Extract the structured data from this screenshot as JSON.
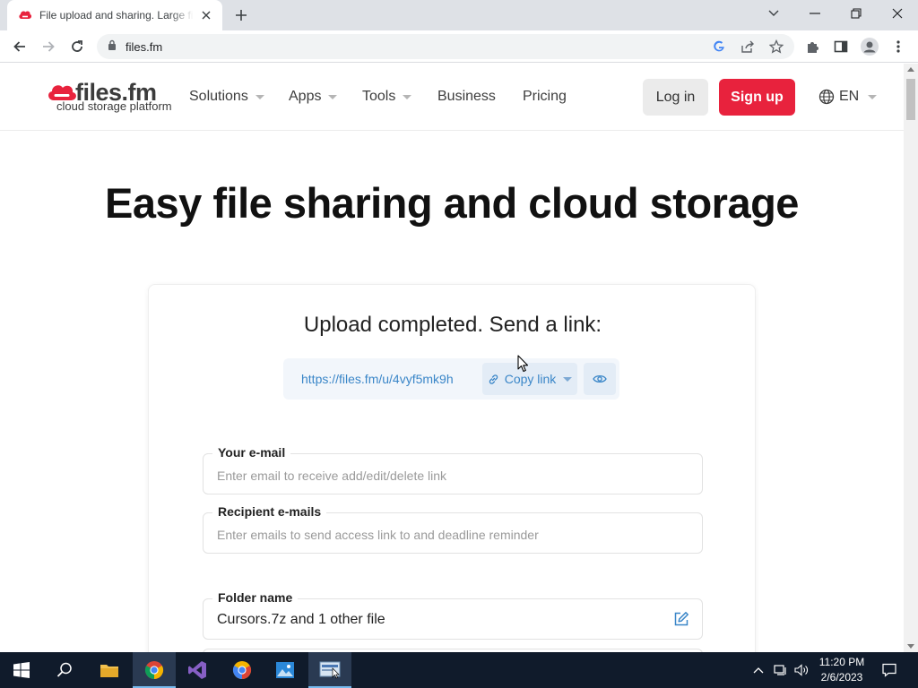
{
  "browser": {
    "tab_title": "File upload and sharing. Large files",
    "url": "files.fm"
  },
  "site": {
    "logo_brand": "files.fm",
    "logo_tagline": "cloud storage platform",
    "nav": {
      "solutions": "Solutions",
      "apps": "Apps",
      "tools": "Tools",
      "business": "Business",
      "pricing": "Pricing"
    },
    "login_label": "Log in",
    "signup_label": "Sign up",
    "language": "EN",
    "colors": {
      "brand_red": "#e8223d",
      "link_blue": "#3a86c8"
    }
  },
  "hero": {
    "title": "Easy file sharing and cloud storage"
  },
  "upload": {
    "title": "Upload completed. Send a link:",
    "link": "https://files.fm/u/4vyf5mk9h",
    "copy_label": "Copy link"
  },
  "form": {
    "your_email_label": "Your e-mail",
    "your_email_placeholder": "Enter email to receive add/edit/delete link",
    "recipient_label": "Recipient e-mails",
    "recipient_placeholder": "Enter emails to send access link to and deadline reminder",
    "folder_label": "Folder name",
    "folder_value": "Cursors.7z and 1 other file"
  },
  "taskbar": {
    "time": "11:20 PM",
    "date": "2/6/2023"
  }
}
